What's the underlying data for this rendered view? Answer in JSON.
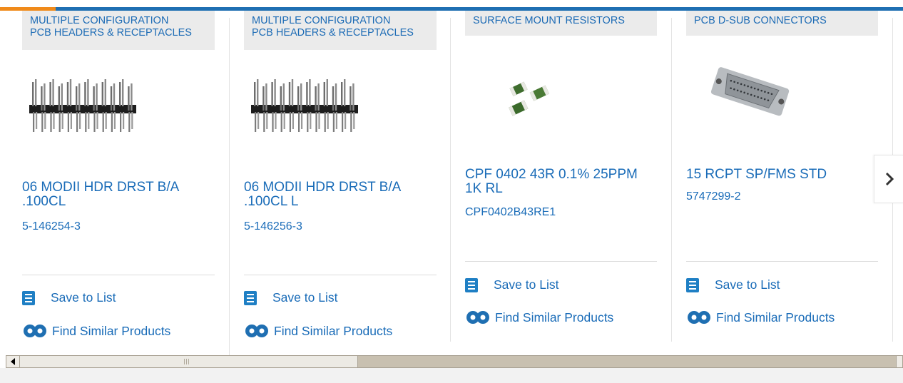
{
  "products": [
    {
      "category": "MULTIPLE CONFIGURATION PCB HEADERS & RECEPTACLES",
      "category_line1": "MULTIPLE CONFIGURATION",
      "category_line2": "PCB HEADERS & RECEPTACLES",
      "name_line1": "06 MODII HDR DRST B/A",
      "name_line2": ".100CL",
      "part_number": "5-146254-3",
      "image": "pin-header-image"
    },
    {
      "category": "MULTIPLE CONFIGURATION PCB HEADERS & RECEPTACLES",
      "category_line1": "MULTIPLE CONFIGURATION",
      "category_line2": "PCB HEADERS & RECEPTACLES",
      "name_line1": "06 MODII HDR DRST B/A",
      "name_line2": ".100CL L",
      "part_number": "5-146256-3",
      "image": "pin-header-image"
    },
    {
      "category": "SURFACE MOUNT RESISTORS",
      "category_line1": "SURFACE MOUNT RESISTORS",
      "category_line2": "",
      "name_line1": "CPF 0402 43R 0.1% 25PPM",
      "name_line2": "1K RL",
      "part_number": "CPF0402B43RE1",
      "image": "smd-resistor-image"
    },
    {
      "category": "PCB D-SUB CONNECTORS",
      "category_line1": "PCB D-SUB CONNECTORS",
      "category_line2": "",
      "name_line1": "15 RCPT SP/FMS STD",
      "name_line2": "",
      "part_number": "5747299-2",
      "image": "dsub-connector-image"
    }
  ],
  "actions": {
    "save_label": "Save to List",
    "similar_label": "Find Similar Products"
  },
  "icons": {
    "save": "checklist-icon",
    "similar": "gears-icon",
    "next": "chevron-right-icon",
    "scroll_left": "triangle-left-icon"
  },
  "colors": {
    "link": "#1a6cb8",
    "brand_bar": "#1f6fb2",
    "accent_bar": "#f08a1a",
    "category_bg": "#ebebeb"
  }
}
